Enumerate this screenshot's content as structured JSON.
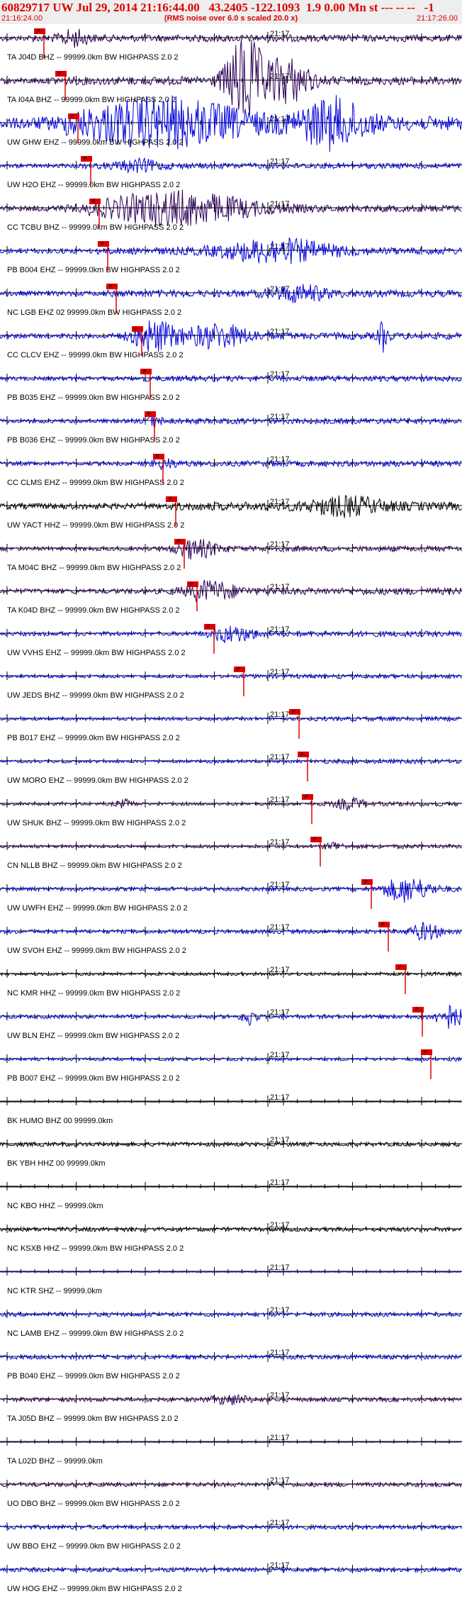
{
  "header": {
    "title": "60829717 UW Jul 29, 2014 21:16:44.00   43.2405 -122.1093  1.9 0.00 Mn st --- -- --   -1",
    "start_time": "21:16:24.00",
    "note": "(RMS noise over 6.0 s scaled 20.0 x)",
    "end_time": "21:17:26.00"
  },
  "minute_label": "21:17",
  "pick_label": "P",
  "colors": {
    "blue": "#0000dd",
    "purple": "#2b0055",
    "black": "#000000",
    "red": "#dd0000"
  },
  "traces": [
    {
      "label": "TA J04D BHZ -- 99999.0km BW  HIGHPASS  2.0  2",
      "color": "purple",
      "amp": 5,
      "pick": 0.06,
      "bursts": [
        [
          0.16,
          0.03,
          2
        ]
      ]
    },
    {
      "label": "TA I04A BHZ -- 99999.0km BW  HIGHPASS  2.0  2",
      "color": "purple",
      "amp": 6,
      "pick": 0.11,
      "bursts": [
        [
          0.53,
          0.04,
          10
        ],
        [
          0.62,
          0.05,
          5
        ]
      ]
    },
    {
      "label": "UW GHW EHZ -- 99999.0km BW  HIGHPASS  2.0  2",
      "color": "blue",
      "amp": 10,
      "pick": 0.14,
      "bursts": [
        [
          0.35,
          0.18,
          3
        ],
        [
          0.72,
          0.07,
          3
        ]
      ]
    },
    {
      "label": "UW H2O EHZ -- 99999.0km BW  HIGHPASS  2.0  2",
      "color": "blue",
      "amp": 4,
      "pick": 0.17,
      "bursts": [
        [
          0.3,
          0.05,
          1.8
        ]
      ]
    },
    {
      "label": "CC TCBU BHZ -- 99999.0km BW  HIGHPASS  2.0  2",
      "color": "purple",
      "amp": 5,
      "pick": 0.19,
      "bursts": [
        [
          0.38,
          0.16,
          4.5
        ]
      ]
    },
    {
      "label": "PB B004 EHZ -- 99999.0km BW  HIGHPASS  2.0  2",
      "color": "blue",
      "amp": 5,
      "pick": 0.21,
      "bursts": [
        [
          0.6,
          0.12,
          3
        ]
      ]
    },
    {
      "label": "NC LGB EHZ 02 99999.0km BW  HIGHPASS  2.0  2",
      "color": "blue",
      "amp": 5,
      "pick": 0.23,
      "bursts": [
        [
          0.65,
          0.06,
          2
        ]
      ]
    },
    {
      "label": "CC CLCV EHZ -- 99999.0km BW  HIGHPASS  2.0  2",
      "color": "blue",
      "amp": 5,
      "pick": 0.29,
      "bursts": [
        [
          0.33,
          0.05,
          4
        ],
        [
          0.47,
          0.07,
          3
        ],
        [
          0.83,
          0.01,
          4
        ]
      ]
    },
    {
      "label": "PB B035 EHZ -- 99999.0km BW  HIGHPASS  2.0  2",
      "color": "blue",
      "amp": 4,
      "pick": 0.31,
      "bursts": []
    },
    {
      "label": "PB B036 EHZ -- 99999.0km BW  HIGHPASS  2.0  2",
      "color": "blue",
      "amp": 4,
      "pick": 0.32,
      "bursts": [
        [
          0.33,
          0.02,
          1.6
        ]
      ]
    },
    {
      "label": "CC CLMS EHZ -- 99999.0km BW  HIGHPASS  2.0  2",
      "color": "blue",
      "amp": 4,
      "pick": 0.34,
      "bursts": [
        [
          0.35,
          0.03,
          1.6
        ]
      ]
    },
    {
      "label": "UW YACT HHZ -- 99999.0km BW  HIGHPASS  2.0  2",
      "color": "black",
      "amp": 6,
      "pick": 0.37,
      "bursts": [
        [
          0.75,
          0.08,
          1.8
        ]
      ]
    },
    {
      "label": "TA M04C BHZ -- 99999.0km BW  HIGHPASS  2.0  2",
      "color": "purple",
      "amp": 4,
      "pick": 0.39,
      "bursts": [
        [
          0.42,
          0.05,
          3
        ]
      ]
    },
    {
      "label": "TA K04D BHZ -- 99999.0km BW  HIGHPASS  2.0  2",
      "color": "purple",
      "amp": 5,
      "pick": 0.42,
      "bursts": [
        [
          0.45,
          0.06,
          2.5
        ]
      ]
    },
    {
      "label": "UW VVHS EHZ -- 99999.0km BW  HIGHPASS  2.0  2",
      "color": "blue",
      "amp": 4,
      "pick": 0.46,
      "bursts": [
        [
          0.5,
          0.05,
          2.5
        ]
      ]
    },
    {
      "label": "UW JEDS BHZ -- 99999.0km BW  HIGHPASS  2.0  2",
      "color": "blue",
      "amp": 3,
      "pick": 0.53,
      "bursts": []
    },
    {
      "label": "PB B017 EHZ -- 99999.0km BW  HIGHPASS  2.0  2",
      "color": "blue",
      "amp": 3,
      "pick": 0.66,
      "bursts": []
    },
    {
      "label": "UW MORO EHZ -- 99999.0km BW  HIGHPASS  2.0  2",
      "color": "blue",
      "amp": 3,
      "pick": 0.68,
      "bursts": []
    },
    {
      "label": "UW SHUK BHZ -- 99999.0km BW  HIGHPASS  2.0  2",
      "color": "purple",
      "amp": 3,
      "pick": 0.69,
      "bursts": [
        [
          0.27,
          0.02,
          2.5
        ],
        [
          0.76,
          0.03,
          2.5
        ]
      ]
    },
    {
      "label": "CN NLLB BHZ -- 99999.0km BW  HIGHPASS  2.0  2",
      "color": "purple",
      "amp": 3,
      "pick": 0.71,
      "bursts": [
        [
          0.72,
          0.02,
          2
        ]
      ]
    },
    {
      "label": "UW UWFH EHZ -- 99999.0km BW  HIGHPASS  2.0  2",
      "color": "blue",
      "amp": 4,
      "pick": 0.83,
      "bursts": [
        [
          0.88,
          0.05,
          4
        ]
      ]
    },
    {
      "label": "UW SVOH EHZ -- 99999.0km BW  HIGHPASS  2.0  2",
      "color": "blue",
      "amp": 4,
      "pick": 0.87,
      "bursts": [
        [
          0.92,
          0.03,
          2.5
        ]
      ]
    },
    {
      "label": "NC KMR HHZ -- 99999.0km BW  HIGHPASS  2.0  2",
      "color": "black",
      "amp": 3,
      "pick": 0.91,
      "bursts": []
    },
    {
      "label": "UW BLN EHZ -- 99999.0km BW  HIGHPASS  2.0  2",
      "color": "blue",
      "amp": 4,
      "pick": 0.95,
      "bursts": [
        [
          0.54,
          0.015,
          4
        ],
        [
          0.97,
          0.03,
          4
        ]
      ]
    },
    {
      "label": "PB B007 EHZ -- 99999.0km BW  HIGHPASS  2.0  2",
      "color": "blue",
      "amp": 3,
      "pick": 0.97,
      "bursts": []
    },
    {
      "label": "BK HUMO BHZ 00 99999.0km",
      "color": "black",
      "amp": 0.3,
      "pick": null,
      "bursts": []
    },
    {
      "label": "BK YBH HHZ 00 99999.0km",
      "color": "black",
      "amp": 3,
      "pick": null,
      "bursts": []
    },
    {
      "label": "NC KBO HHZ -- 99999.0km",
      "color": "black",
      "amp": 0.3,
      "pick": null,
      "bursts": []
    },
    {
      "label": "NC KSXB HHZ -- 99999.0km BW  HIGHPASS  2.0  2",
      "color": "black",
      "amp": 3,
      "pick": null,
      "bursts": []
    },
    {
      "label": "NC KTR SHZ -- 99999.0km",
      "color": "blue",
      "amp": 0.3,
      "pick": null,
      "bursts": []
    },
    {
      "label": "NC LAMB EHZ -- 99999.0km BW  HIGHPASS  2.0  2",
      "color": "blue",
      "amp": 3,
      "pick": null,
      "bursts": []
    },
    {
      "label": "PB B040 EHZ -- 99999.0km BW  HIGHPASS  2.0  2",
      "color": "blue",
      "amp": 3,
      "pick": null,
      "bursts": []
    },
    {
      "label": "TA J05D BHZ -- 99999.0km BW  HIGHPASS  2.0  2",
      "color": "purple",
      "amp": 3,
      "pick": null,
      "bursts": [
        [
          0.5,
          0.04,
          2
        ]
      ]
    },
    {
      "label": "TA L02D BHZ -- 99999.0km",
      "color": "purple",
      "amp": 0.3,
      "pick": null,
      "bursts": []
    },
    {
      "label": "UO DBO BHZ -- 99999.0km BW  HIGHPASS  2.0  2",
      "color": "purple",
      "amp": 3,
      "pick": null,
      "bursts": []
    },
    {
      "label": "UW BBO EHZ -- 99999.0km BW  HIGHPASS  2.0  2",
      "color": "blue",
      "amp": 3,
      "pick": null,
      "bursts": []
    },
    {
      "label": "UW HOG EHZ -- 99999.0km BW  HIGHPASS  2.0  2",
      "color": "blue",
      "amp": 3,
      "pick": null,
      "bursts": []
    }
  ]
}
